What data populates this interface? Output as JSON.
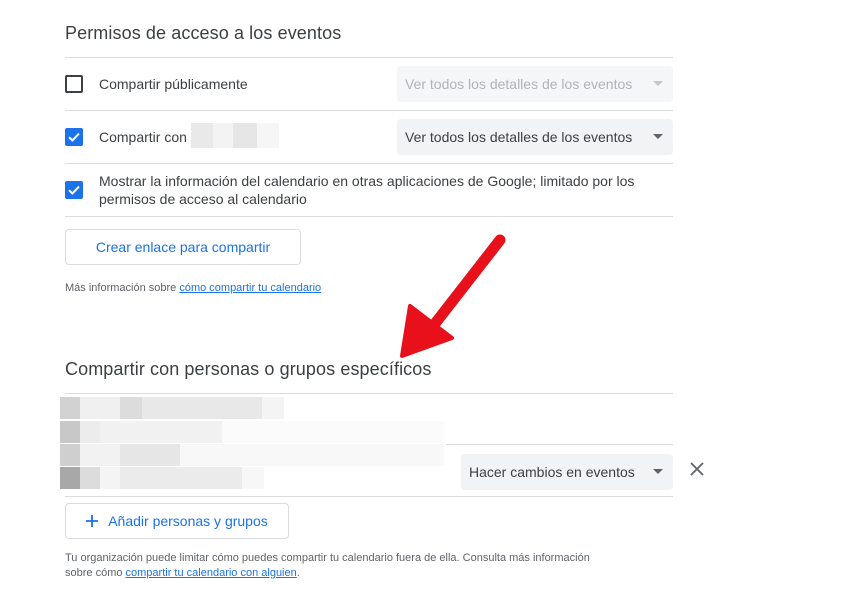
{
  "section1": {
    "title": "Permisos de acceso a los eventos",
    "public_share": {
      "label": "Compartir públicamente",
      "checked": false,
      "select_value": "Ver todos los detalles de los eventos",
      "disabled": true
    },
    "share_with": {
      "label": "Compartir con",
      "checked": true,
      "select_value": "Ver todos los detalles de los eventos"
    },
    "show_info": {
      "label_line1": "Mostrar la información del calendario en otras aplicaciones de Google; limitado por los",
      "label_line2": "permisos de acceso al calendario",
      "checked": true
    },
    "create_link_button": "Crear enlace para compartir",
    "more_info_prefix": "Más información sobre ",
    "more_info_link": "cómo compartir tu calendario"
  },
  "section2": {
    "title": "Compartir con personas o grupos específicos",
    "person_permission": "Hacer cambios en eventos",
    "add_button": "Añadir personas y grupos",
    "footer_line1": "Tu organización puede limitar cómo puedes compartir tu calendario fuera de ella. Consulta más información",
    "footer_line2_prefix": "sobre cómo ",
    "footer_link": "compartir tu calendario con alguien",
    "footer_suffix": "."
  },
  "colors": {
    "accent": "#1a73e8",
    "arrow": "#e8101a"
  },
  "icons": {
    "checkbox_checked": "check-icon",
    "remove": "close-icon",
    "add": "plus-icon",
    "dropdown": "caret-down-icon",
    "annotation": "red-arrow-icon"
  }
}
